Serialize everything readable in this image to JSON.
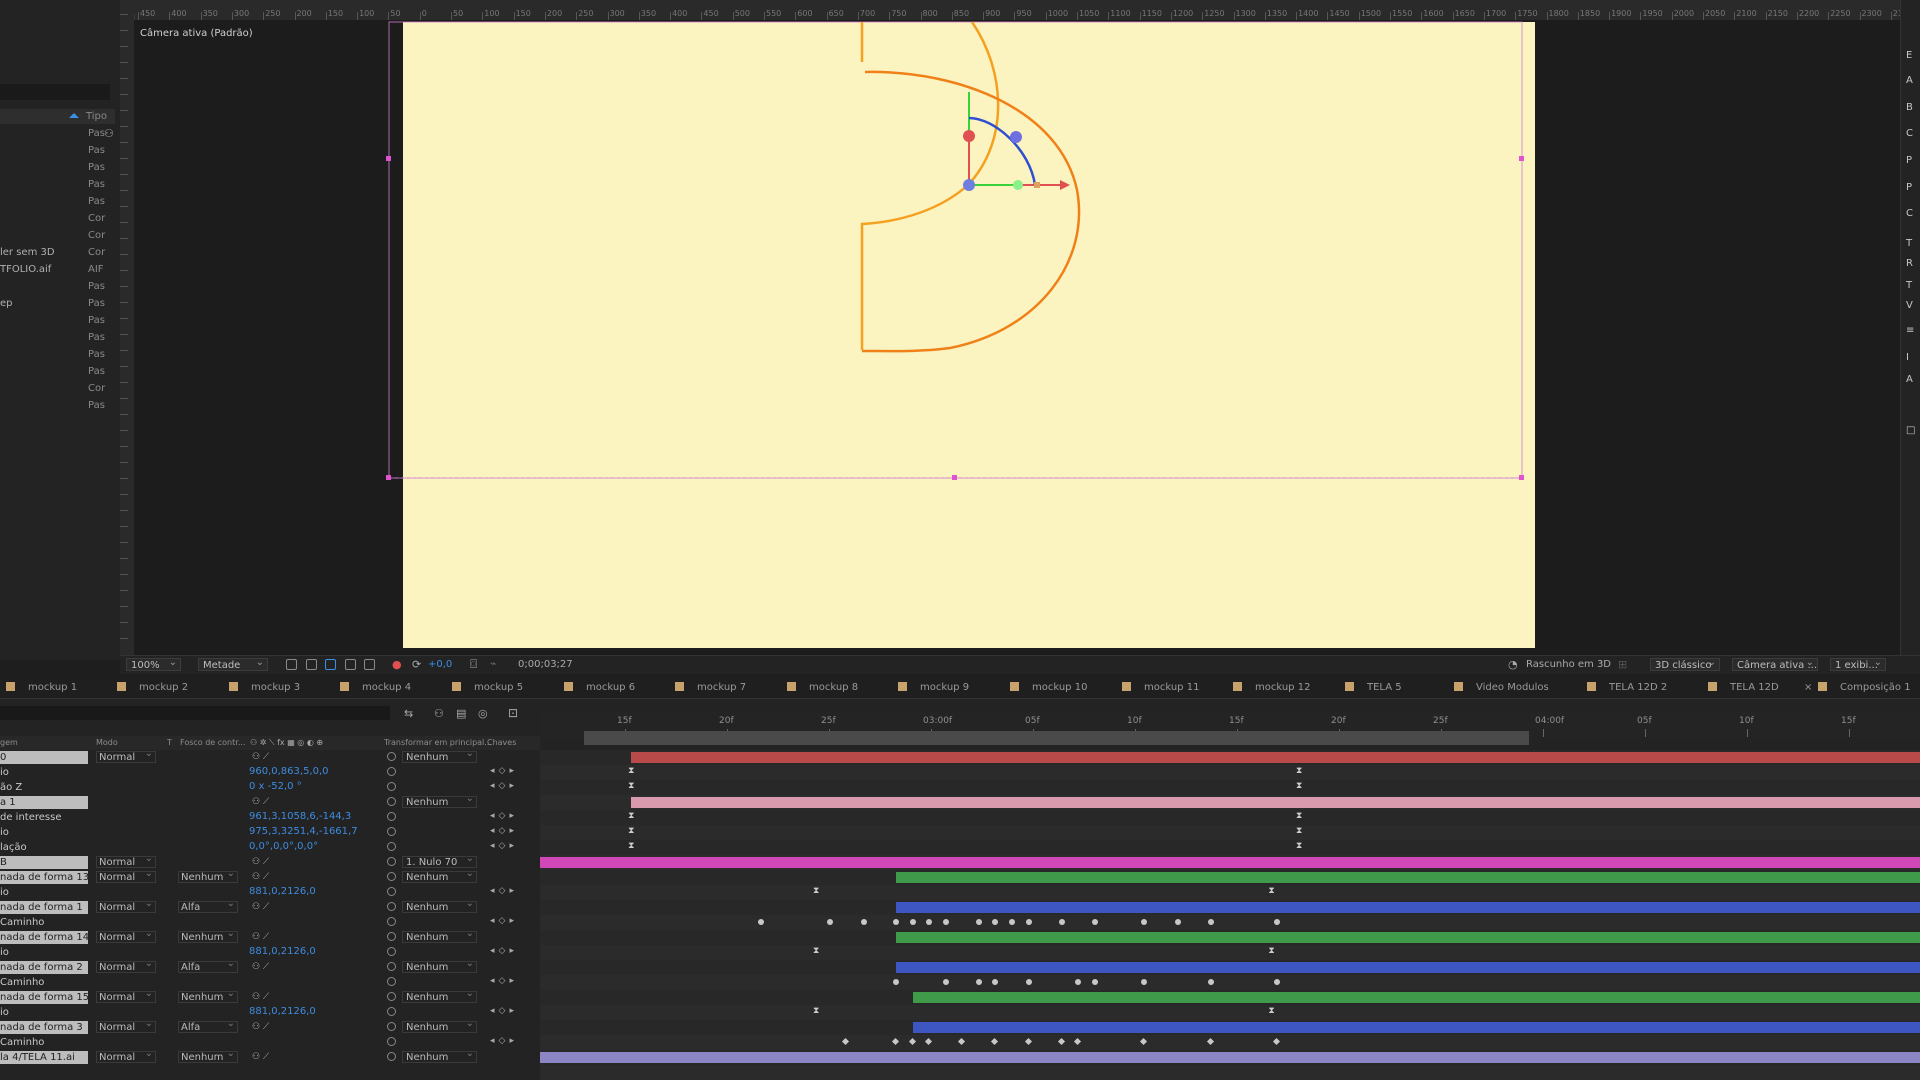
{
  "project": {
    "header_type": "Tipo",
    "rows": [
      {
        "name": "",
        "type": "Pas"
      },
      {
        "name": "",
        "type": "Pas"
      },
      {
        "name": "",
        "type": "Pas"
      },
      {
        "name": "",
        "type": "Pas"
      },
      {
        "name": "",
        "type": "Pas"
      },
      {
        "name": "",
        "type": "Cor"
      },
      {
        "name": "",
        "type": "Cor"
      },
      {
        "name": "ler sem 3D",
        "type": "Cor"
      },
      {
        "name": "TFOLIO.aif",
        "type": "AIF"
      },
      {
        "name": "",
        "type": "Pas"
      },
      {
        "name": "ep",
        "type": "Pas"
      },
      {
        "name": "",
        "type": "Pas"
      },
      {
        "name": "",
        "type": "Pas"
      },
      {
        "name": "",
        "type": "Pas"
      },
      {
        "name": "",
        "type": "Pas"
      },
      {
        "name": "",
        "type": "Cor"
      },
      {
        "name": "",
        "type": "Pas"
      }
    ]
  },
  "ruler_labels": [
    "450",
    "400",
    "350",
    "300",
    "250",
    "200",
    "150",
    "100",
    "50",
    "0",
    "50",
    "100",
    "150",
    "200",
    "250",
    "300",
    "350",
    "400",
    "450",
    "500",
    "550",
    "600",
    "650",
    "700",
    "750",
    "800",
    "850",
    "900",
    "950",
    "1000",
    "1050",
    "1100",
    "1150",
    "1200",
    "1250",
    "1300",
    "1350",
    "1400",
    "1450",
    "1500",
    "1550",
    "1600",
    "1650",
    "1700",
    "1750",
    "1800",
    "1850",
    "1900",
    "1950",
    "2000",
    "2050",
    "2100",
    "2150",
    "2200",
    "2250",
    "2300",
    "2350"
  ],
  "viewer": {
    "camera_label": "Câmera ativa (Padrão)"
  },
  "viewer_bar": {
    "zoom": "100%",
    "resolution": "Metade",
    "exposure": "+0,0",
    "timecode": "0;00;03;27",
    "renderer": "Rascunho em 3D",
    "view_mode": "3D clássico",
    "camera": "Câmera ativa ...",
    "views": "1 exibi..."
  },
  "tabs": [
    "mockup 1",
    "mockup 2",
    "mockup 3",
    "mockup 4",
    "mockup 5",
    "mockup 6",
    "mockup 7",
    "mockup 8",
    "mockup 9",
    "mockup 10",
    "mockup 11",
    "mockup 12",
    "TELA 5",
    "Video Modulos",
    "TELA 12D 2",
    "TELA 12D",
    "Composição 1"
  ],
  "timeline_columns": {
    "name": "gem",
    "mode": "Modo",
    "t": "T",
    "matte": "Fosco de contr...",
    "parent": "Transformar em principal...",
    "keys": "Chaves"
  },
  "time_labels": [
    "15f",
    "20f",
    "25f",
    "03:00f",
    "05f",
    "10f",
    "15f",
    "20f",
    "25f",
    "04:00f",
    "05f",
    "10f",
    "15f"
  ],
  "layers": [
    {
      "name": "0",
      "hl": true,
      "mode": "Normal",
      "matte": "",
      "parent": "Nenhum",
      "value": "",
      "bar": {
        "from": 0.066,
        "to": 1.0,
        "color": "#b94a4a"
      }
    },
    {
      "name": "io",
      "value": "960,0,863,5,0,0",
      "keys": [
        0.066,
        0.55
      ]
    },
    {
      "name": "ão Z",
      "value": "0 x -52,0 °",
      "keys": [
        0.066,
        0.55
      ]
    },
    {
      "name": "a 1",
      "hl": true,
      "parent": "Nenhum",
      "bar": {
        "from": 0.066,
        "to": 1.0,
        "color": "#d99aae"
      }
    },
    {
      "name": "de interesse",
      "value": "961,3,1058,6,-144,3",
      "keys": [
        0.066,
        0.55
      ]
    },
    {
      "name": "io",
      "value": "975,3,3251,4,-1661,7",
      "keys": [
        0.066,
        0.55
      ]
    },
    {
      "name": "lação",
      "value": "0,0°,0,0°,0,0°",
      "keys": [
        0.066,
        0.55
      ]
    },
    {
      "name": "B",
      "hl": true,
      "mode": "Normal",
      "parent": "1. Nulo 70",
      "bar": {
        "from": 0.0,
        "to": 1.0,
        "color": "#d048b8"
      }
    },
    {
      "name": "nada de forma 13",
      "hl": true,
      "mode": "Normal",
      "matte": "Nenhum",
      "parent": "Nenhum",
      "bar": {
        "from": 0.258,
        "to": 1.0,
        "color": "#3f9a4a"
      }
    },
    {
      "name": "io",
      "value": "881,0,2126,0",
      "keys": [
        0.2,
        0.53
      ]
    },
    {
      "name": "nada de forma 1",
      "hl": true,
      "mode": "Normal",
      "matte": "Alfa",
      "parent": "Nenhum",
      "bar": {
        "from": 0.258,
        "to": 1.0,
        "color": "#3d56c2"
      }
    },
    {
      "name": "Caminho",
      "dots": [
        0.16,
        0.21,
        0.235,
        0.258,
        0.27,
        0.282,
        0.294,
        0.318,
        0.33,
        0.342,
        0.354,
        0.378,
        0.402,
        0.438,
        0.462,
        0.486,
        0.534
      ]
    },
    {
      "name": "nada de forma 14",
      "hl": true,
      "mode": "Normal",
      "matte": "Nenhum",
      "parent": "Nenhum",
      "bar": {
        "from": 0.258,
        "to": 1.0,
        "color": "#3f9a4a"
      }
    },
    {
      "name": "io",
      "value": "881,0,2126,0",
      "keys": [
        0.2,
        0.53
      ]
    },
    {
      "name": "nada de forma 2",
      "hl": true,
      "mode": "Normal",
      "matte": "Alfa",
      "parent": "Nenhum",
      "bar": {
        "from": 0.258,
        "to": 1.0,
        "color": "#3d56c2"
      }
    },
    {
      "name": "Caminho",
      "dots": [
        0.258,
        0.294,
        0.318,
        0.33,
        0.354,
        0.39,
        0.402,
        0.438,
        0.486,
        0.534
      ]
    },
    {
      "name": "nada de forma 15",
      "hl": true,
      "mode": "Normal",
      "matte": "Nenhum",
      "parent": "Nenhum",
      "bar": {
        "from": 0.27,
        "to": 1.0,
        "color": "#3f9a4a"
      }
    },
    {
      "name": "io",
      "value": "881,0,2126,0",
      "keys": [
        0.2,
        0.53
      ]
    },
    {
      "name": "nada de forma 3",
      "hl": true,
      "mode": "Normal",
      "matte": "Alfa",
      "parent": "Nenhum",
      "bar": {
        "from": 0.27,
        "to": 1.0,
        "color": "#3d56c2"
      }
    },
    {
      "name": "Caminho",
      "diamonds": [
        0.222,
        0.258,
        0.27,
        0.282,
        0.306,
        0.33,
        0.354,
        0.378,
        0.39,
        0.438,
        0.486,
        0.534
      ]
    },
    {
      "name": "la 4/TELA 11.ai",
      "hl": true,
      "mode": "Normal",
      "matte": "Nenhum",
      "parent": "Nenhum",
      "bar": {
        "from": 0.0,
        "to": 1.0,
        "color": "#8d86c4"
      }
    }
  ],
  "playhead": 0.573,
  "colors": {
    "canvas": "#fbf4c0",
    "shape_stroke": "#f5a020",
    "accent_blue": "#3a8ee6",
    "playhead_red": "#e02020"
  }
}
